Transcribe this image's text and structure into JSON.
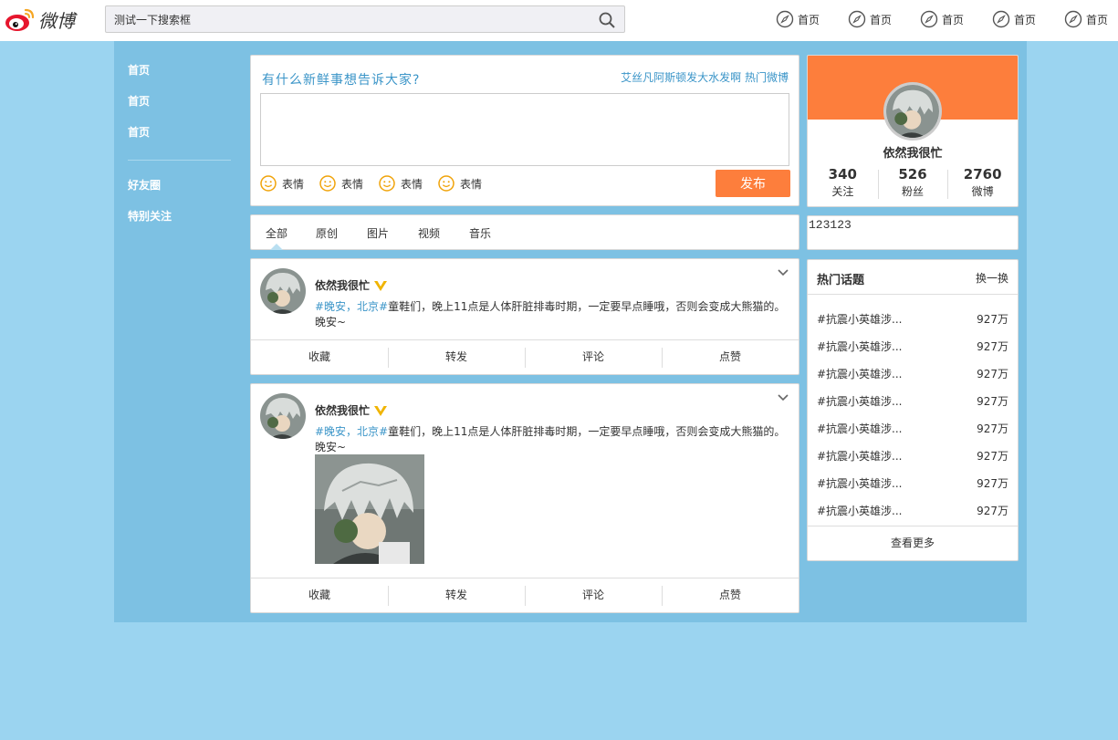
{
  "header": {
    "logo_text": "微博",
    "search_value": "测试一下搜索框",
    "nav": [
      "首页",
      "首页",
      "首页",
      "首页",
      "首页"
    ]
  },
  "sidebar": {
    "items": [
      "首页",
      "首页",
      "首页"
    ],
    "items2": [
      "好友圈",
      "特别关注"
    ]
  },
  "composer": {
    "prompt": "有什么新鲜事想告诉大家?",
    "links": [
      "艾丝凡阿斯顿发大水发啊",
      "热门微博"
    ],
    "emojis": [
      "表情",
      "表情",
      "表情",
      "表情"
    ],
    "publish_label": "发布"
  },
  "tabs": [
    "全部",
    "原创",
    "图片",
    "视频",
    "音乐"
  ],
  "posts": [
    {
      "author": "依然我很忙",
      "tags": "#晚安，北京#",
      "text": "童鞋们，晚上11点是人体肝脏排毒时期，一定要早点睡哦，否则会变成大熊猫的。晚安~",
      "actions": [
        "收藏",
        "转发",
        "评论",
        "点赞"
      ]
    },
    {
      "author": "依然我很忙",
      "tags": "#晚安，北京#",
      "text": "童鞋们，晚上11点是人体肝脏排毒时期，一定要早点睡哦，否则会变成大熊猫的。晚安~",
      "actions": [
        "收藏",
        "转发",
        "评论",
        "点赞"
      ]
    }
  ],
  "profile": {
    "name": "依然我很忙",
    "stats": [
      {
        "num": "340",
        "label": "关注"
      },
      {
        "num": "526",
        "label": "粉丝"
      },
      {
        "num": "2760",
        "label": "微博"
      }
    ]
  },
  "note_text": "123123",
  "hot": {
    "title": "热门话题",
    "refresh": "换一换",
    "items": [
      {
        "topic": "#抗震小英雄涉...",
        "count": "927万"
      },
      {
        "topic": "#抗震小英雄涉...",
        "count": "927万"
      },
      {
        "topic": "#抗震小英雄涉...",
        "count": "927万"
      },
      {
        "topic": "#抗震小英雄涉...",
        "count": "927万"
      },
      {
        "topic": "#抗震小英雄涉...",
        "count": "927万"
      },
      {
        "topic": "#抗震小英雄涉...",
        "count": "927万"
      },
      {
        "topic": "#抗震小英雄涉...",
        "count": "927万"
      },
      {
        "topic": "#抗震小英雄涉...",
        "count": "927万"
      }
    ],
    "more": "查看更多"
  },
  "colors": {
    "accent_orange": "#fd7e3c",
    "link_blue": "#3b95c8",
    "page_bg": "#9bd4f0",
    "main_bg": "#7dc1e3"
  }
}
